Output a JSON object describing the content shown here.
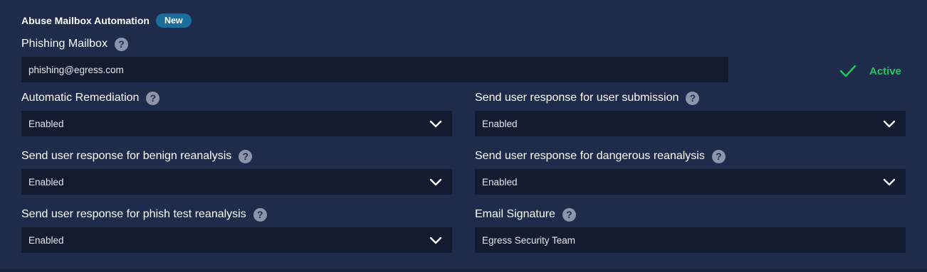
{
  "section": {
    "title": "Abuse Mailbox Automation",
    "badge": "New"
  },
  "phishing_mailbox": {
    "label": "Phishing Mailbox",
    "value": "phishing@egress.com",
    "help_icon": "question-mark-icon"
  },
  "status": {
    "label": "Active",
    "icon": "check-icon",
    "color": "#22c55e"
  },
  "fields": {
    "automatic_remediation": {
      "label": "Automatic Remediation",
      "value": "Enabled"
    },
    "user_submission": {
      "label": "Send user response for user submission",
      "value": "Enabled"
    },
    "benign_reanalysis": {
      "label": "Send user response for benign reanalysis",
      "value": "Enabled"
    },
    "dangerous_reanalysis": {
      "label": "Send user response for dangerous reanalysis",
      "value": "Enabled"
    },
    "phish_test_reanalysis": {
      "label": "Send user response for phish test reanalysis",
      "value": "Enabled"
    },
    "email_signature": {
      "label": "Email Signature",
      "value": "Egress Security Team"
    }
  },
  "colors": {
    "background": "#1e2b4a",
    "input_background": "#131b31",
    "badge": "#1a6e9b",
    "help_icon": "#8c95aa"
  }
}
